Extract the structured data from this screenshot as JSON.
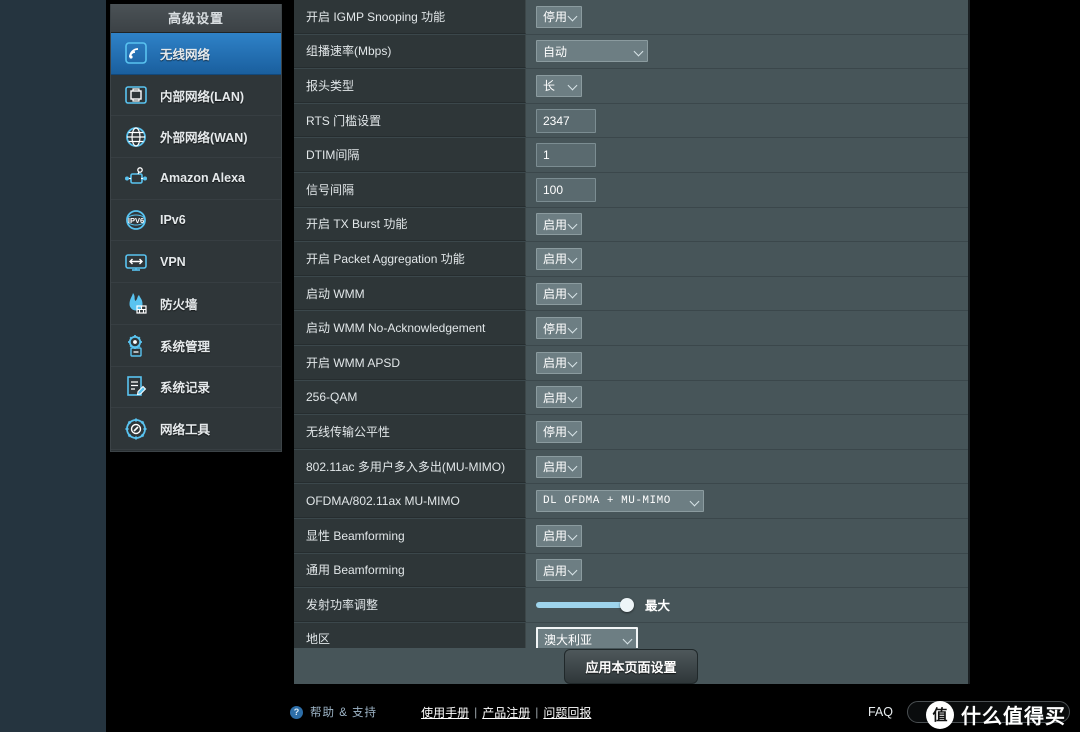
{
  "sidebar": {
    "title": "高级设置",
    "items": [
      {
        "label": "无线网络",
        "icon": "wifi-signal-icon",
        "active": true
      },
      {
        "label": "内部网络(LAN)",
        "icon": "lan-port-icon",
        "active": false
      },
      {
        "label": "外部网络(WAN)",
        "icon": "globe-icon",
        "active": false
      },
      {
        "label": "Amazon Alexa",
        "icon": "alexa-network-icon",
        "active": false
      },
      {
        "label": "IPv6",
        "icon": "ipv6-globe-icon",
        "active": false
      },
      {
        "label": "VPN",
        "icon": "vpn-monitor-icon",
        "active": false
      },
      {
        "label": "防火墙",
        "icon": "firewall-flame-icon",
        "active": false
      },
      {
        "label": "系统管理",
        "icon": "gear-admin-icon",
        "active": false
      },
      {
        "label": "系统记录",
        "icon": "log-document-icon",
        "active": false
      },
      {
        "label": "网络工具",
        "icon": "network-tools-icon",
        "active": false
      }
    ]
  },
  "settings": {
    "rows": [
      {
        "label": "开启 IGMP Snooping 功能",
        "control": "select-small",
        "value": "停用"
      },
      {
        "label": "组播速率(Mbps)",
        "control": "select-mid",
        "value": "自动"
      },
      {
        "label": "报头类型",
        "control": "select-small",
        "value": "长"
      },
      {
        "label": "RTS 门槛设置",
        "control": "text",
        "value": "2347"
      },
      {
        "label": "DTIM间隔",
        "control": "text",
        "value": "1"
      },
      {
        "label": "信号间隔",
        "control": "text",
        "value": "100"
      },
      {
        "label": "开启 TX Burst 功能",
        "control": "select-small",
        "value": "启用"
      },
      {
        "label": "开启 Packet Aggregation 功能",
        "control": "select-small",
        "value": "启用"
      },
      {
        "label": "启动 WMM",
        "control": "select-small",
        "value": "启用"
      },
      {
        "label": "启动 WMM No-Acknowledgement",
        "control": "select-small",
        "value": "停用"
      },
      {
        "label": "开启 WMM APSD",
        "control": "select-small",
        "value": "启用"
      },
      {
        "label": "256-QAM",
        "control": "select-small",
        "value": "启用"
      },
      {
        "label": "无线传输公平性",
        "control": "select-small",
        "value": "停用"
      },
      {
        "label": "802.11ac 多用户多入多出(MU-MIMO)",
        "control": "select-small",
        "value": "启用"
      },
      {
        "label": "OFDMA/802.11ax MU-MIMO",
        "control": "select-wide",
        "value": "DL  OFDMA  +  MU-MIMO"
      },
      {
        "label": "显性 Beamforming",
        "control": "select-small",
        "value": "启用"
      },
      {
        "label": "通用 Beamforming",
        "control": "select-small",
        "value": "启用"
      },
      {
        "label": "发射功率调整",
        "control": "slider",
        "value": "最大"
      },
      {
        "label": "地区",
        "control": "select-region",
        "value": "澳大利亚"
      }
    ],
    "apply_label": "应用本页面设置"
  },
  "footer": {
    "help_icon": "question-mark-icon",
    "help_label": "帮助 & 支持",
    "links": [
      "使用手册",
      "产品注册",
      "问题回报"
    ],
    "separator": "|",
    "faq_label": "FAQ",
    "search_value": ""
  },
  "watermark": {
    "badge": "值",
    "text": "什么值得买"
  },
  "colors": {
    "accent_blue": "#2f82c8",
    "panel_bg": "#475559",
    "label_col_bg": "#2e3638",
    "slider_fill": "#9ed4ec"
  }
}
